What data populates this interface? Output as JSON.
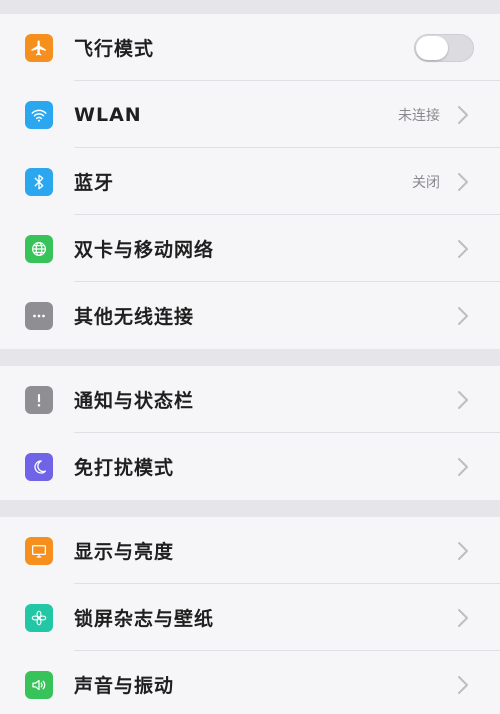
{
  "colors": {
    "background": "#e6e5ea",
    "group_background": "#f6f6f8",
    "label_text": "#1f1f1f",
    "secondary_text": "#8a8a8e",
    "chevron": "#bdbdc2"
  },
  "groups": [
    {
      "items": [
        {
          "label": "飞行模式",
          "icon": "airplane-icon",
          "icon_color": "#f5901e",
          "control": "toggle",
          "toggle_on": false
        },
        {
          "label": "WLAN",
          "icon": "wifi-icon",
          "icon_color": "#2aa7ee",
          "value": "未连接",
          "control": "chevron"
        },
        {
          "label": "蓝牙",
          "icon": "bluetooth-icon",
          "icon_color": "#2aa7ee",
          "value": "关闭",
          "control": "chevron"
        },
        {
          "label": "双卡与移动网络",
          "icon": "globe-icon",
          "icon_color": "#37c25a",
          "control": "chevron"
        },
        {
          "label": "其他无线连接",
          "icon": "more-icon",
          "icon_color": "#8e8e93",
          "control": "chevron"
        }
      ]
    },
    {
      "items": [
        {
          "label": "通知与状态栏",
          "icon": "notification-icon",
          "icon_color": "#8e8e93",
          "control": "chevron"
        },
        {
          "label": "免打扰模式",
          "icon": "moon-icon",
          "icon_color": "#6f63e8",
          "control": "chevron"
        }
      ]
    },
    {
      "items": [
        {
          "label": "显示与亮度",
          "icon": "display-icon",
          "icon_color": "#f5901e",
          "control": "chevron"
        },
        {
          "label": "锁屏杂志与壁纸",
          "icon": "flower-icon",
          "icon_color": "#22c7a5",
          "control": "chevron"
        },
        {
          "label": "声音与振动",
          "icon": "speaker-icon",
          "icon_color": "#37c25a",
          "control": "chevron"
        }
      ]
    }
  ]
}
